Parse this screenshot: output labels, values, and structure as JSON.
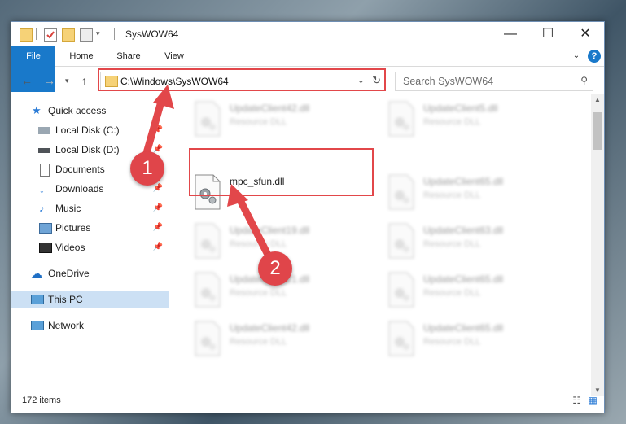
{
  "window": {
    "title": "SysWOW64"
  },
  "ribbon": {
    "tabs": [
      "File",
      "Home",
      "Share",
      "View"
    ]
  },
  "navigation": {
    "address_path": "C:\\Windows\\SysWOW64",
    "search_placeholder": "Search SysWOW64"
  },
  "sidebar": {
    "items": [
      {
        "label": "Quick access"
      },
      {
        "label": "Local Disk (C:)"
      },
      {
        "label": "Local Disk (D:)"
      },
      {
        "label": "Documents"
      },
      {
        "label": "Downloads"
      },
      {
        "label": "Music"
      },
      {
        "label": "Pictures"
      },
      {
        "label": "Videos"
      },
      {
        "label": "OneDrive"
      },
      {
        "label": "This PC"
      },
      {
        "label": "Network"
      }
    ]
  },
  "files": [
    {
      "name": "UpdateClient42.dll",
      "type": "Resource DLL"
    },
    {
      "name": "UpdateClient5.dll",
      "type": "Resource DLL"
    },
    {
      "name": "mpc_sfun.dll",
      "type": ""
    },
    {
      "name": "UpdateClient65.dll",
      "type": "Resource DLL"
    },
    {
      "name": "UpdateClient19.dll",
      "type": "Resource DLL"
    },
    {
      "name": "UpdateClient63.dll",
      "type": "Resource DLL"
    },
    {
      "name": "UpdateClient21.dll",
      "type": "Resource DLL"
    },
    {
      "name": "UpdateClient65.dll",
      "type": "Resource DLL"
    },
    {
      "name": "UpdateClient42.dll",
      "type": "Resource DLL"
    },
    {
      "name": "UpdateClient65.dll",
      "type": "Resource DLL"
    }
  ],
  "status": {
    "item_count": "172 items"
  },
  "annotations": {
    "step1": "1",
    "step2": "2"
  },
  "colors": {
    "accent": "#1979ca",
    "highlight_red": "#e2474a",
    "selection": "#cce0f4"
  }
}
